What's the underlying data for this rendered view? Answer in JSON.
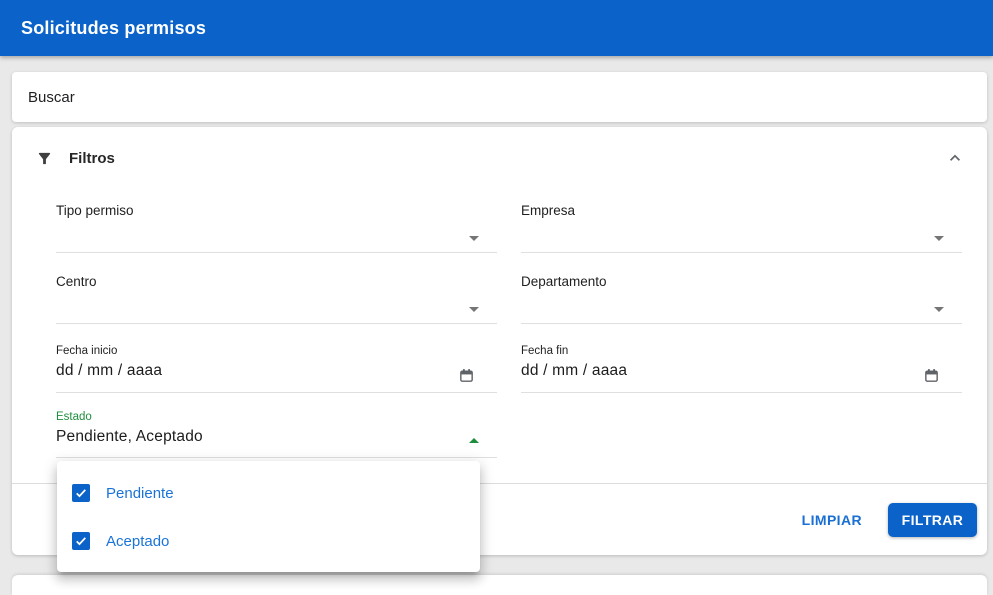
{
  "appbar": {
    "title": "Solicitudes permisos"
  },
  "search": {
    "placeholder": "Buscar"
  },
  "filters": {
    "title": "Filtros",
    "fields": [
      {
        "label": "Tipo permiso",
        "type": "select"
      },
      {
        "label": "Empresa",
        "type": "select"
      },
      {
        "label": "Centro",
        "type": "select"
      },
      {
        "label": "Departamento",
        "type": "select"
      },
      {
        "label": "Fecha inicio",
        "type": "date",
        "value": "dd / mm / aaaa"
      },
      {
        "label": "Fecha fin",
        "type": "date",
        "value": "dd / mm / aaaa"
      },
      {
        "label": "Estado",
        "type": "multiselect",
        "value": "Pendiente, Aceptado"
      }
    ],
    "actions": {
      "clear": "LIMPIAR",
      "apply": "FILTRAR"
    }
  },
  "estado_dropdown": {
    "options": [
      {
        "label": "Pendiente",
        "checked": true
      },
      {
        "label": "Aceptado",
        "checked": true
      }
    ]
  },
  "colors": {
    "primary": "#0b63c9",
    "option_text": "#1a73d8",
    "active_label_green": "#1e8e3e",
    "background": "#e9e9e9"
  }
}
